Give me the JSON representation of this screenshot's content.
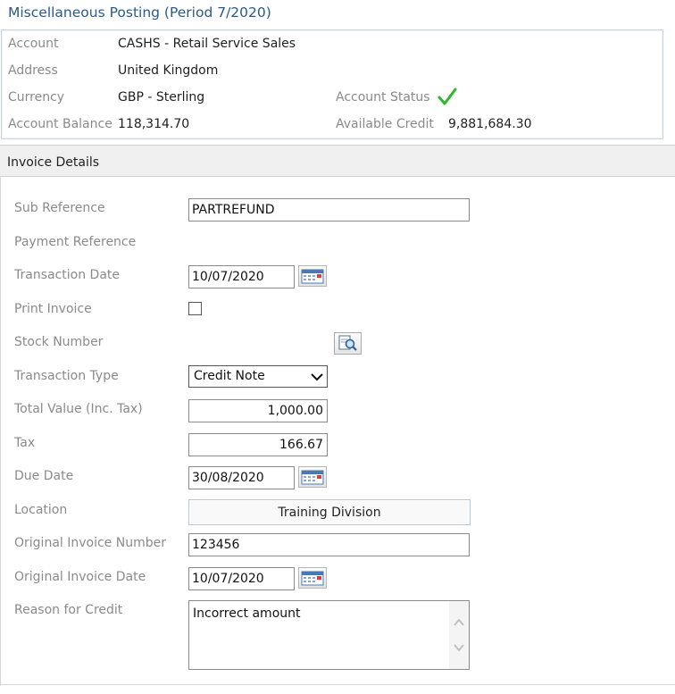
{
  "page": {
    "title": "Miscellaneous Posting (Period 7/2020)"
  },
  "account": {
    "account_label": "Account",
    "account_value": "CASHS - Retail Service Sales",
    "address_label": "Address",
    "address_value": "United Kingdom",
    "currency_label": "Currency",
    "currency_value": "GBP - Sterling",
    "status_label": "Account Status",
    "status_icon": "checkmark-icon",
    "status_color": "#2eb82e",
    "balance_label": "Account Balance",
    "balance_value": "118,314.70",
    "credit_label": "Available Credit",
    "credit_value": "9,881,684.30"
  },
  "invoice": {
    "section_title": "Invoice Details",
    "sub_reference_label": "Sub Reference",
    "sub_reference_value": "PARTREFUND",
    "payment_reference_label": "Payment Reference",
    "transaction_date_label": "Transaction Date",
    "transaction_date_value": "10/07/2020",
    "print_invoice_label": "Print Invoice",
    "print_invoice_checked": false,
    "stock_number_label": "Stock Number",
    "transaction_type_label": "Transaction Type",
    "transaction_type_value": "Credit Note",
    "total_value_label": "Total Value (Inc. Tax)",
    "total_value_value": "1,000.00",
    "tax_label": "Tax",
    "tax_value": "166.67",
    "due_date_label": "Due Date",
    "due_date_value": "30/08/2020",
    "location_label": "Location",
    "location_value": "Training Division",
    "original_invoice_number_label": "Original Invoice Number",
    "original_invoice_number_value": "123456",
    "original_invoice_date_label": "Original Invoice Date",
    "original_invoice_date_value": "10/07/2020",
    "reason_label": "Reason for Credit",
    "reason_value": "Incorrect amount"
  },
  "colors": {
    "title": "#2a5a8a",
    "label": "#8a8a8a",
    "section_bg": "#f0f0f0"
  }
}
